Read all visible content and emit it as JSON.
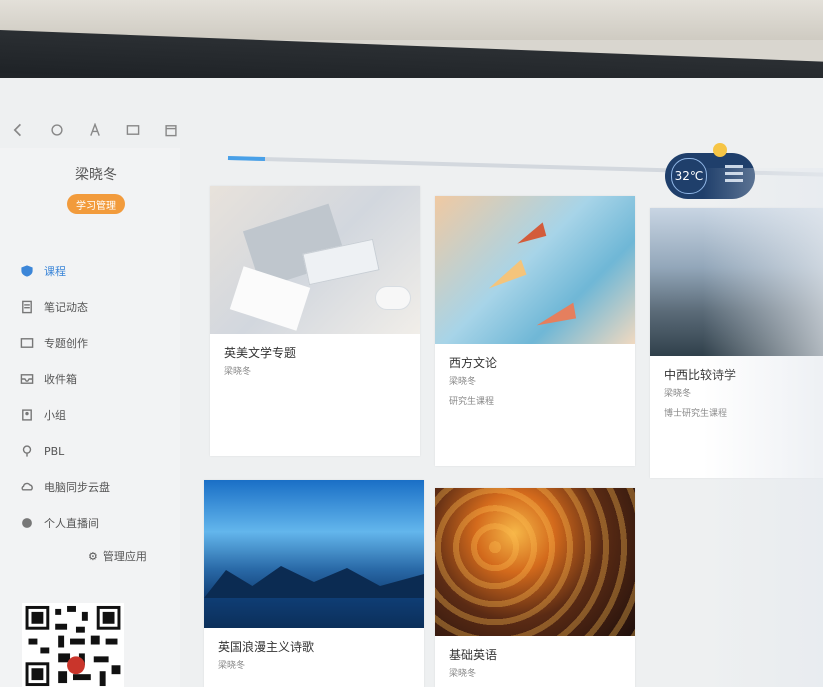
{
  "user": {
    "name": "梁晓冬",
    "role_badge": "学习管理"
  },
  "nav": {
    "items": [
      {
        "label": "课程",
        "icon": "shield-icon",
        "active": true
      },
      {
        "label": "笔记动态",
        "icon": "note-icon",
        "active": false
      },
      {
        "label": "专题创作",
        "icon": "folder-icon",
        "active": false
      },
      {
        "label": "收件箱",
        "icon": "inbox-icon",
        "active": false
      },
      {
        "label": "小组",
        "icon": "group-icon",
        "active": false
      },
      {
        "label": "PBL",
        "icon": "pin-icon",
        "active": false
      },
      {
        "label": "电脑同步云盘",
        "icon": "cloud-icon",
        "active": false
      },
      {
        "label": "个人直播间",
        "icon": "live-icon",
        "active": false
      }
    ],
    "manage_label": "管理应用"
  },
  "weather": {
    "temp": "32℃",
    "colors": {
      "accent": "#1f3f6b",
      "sun": "#f6c545"
    }
  },
  "progress": {
    "value": 0.06
  },
  "courses": [
    {
      "title": "英美文学专题",
      "author": "梁晓冬",
      "subtitle": ""
    },
    {
      "title": "西方文论",
      "author": "梁晓冬",
      "subtitle": "研究生课程"
    },
    {
      "title": "中西比较诗学",
      "author": "梁晓冬",
      "subtitle": "博士研究生课程"
    },
    {
      "title": "英国浪漫主义诗歌",
      "author": "梁晓冬",
      "subtitle": ""
    },
    {
      "title": "基础英语",
      "author": "梁晓冬",
      "subtitle": ""
    }
  ],
  "toolbar": {
    "icons": [
      "back-icon",
      "refresh-icon",
      "font-icon",
      "window-icon",
      "calendar-icon"
    ]
  }
}
